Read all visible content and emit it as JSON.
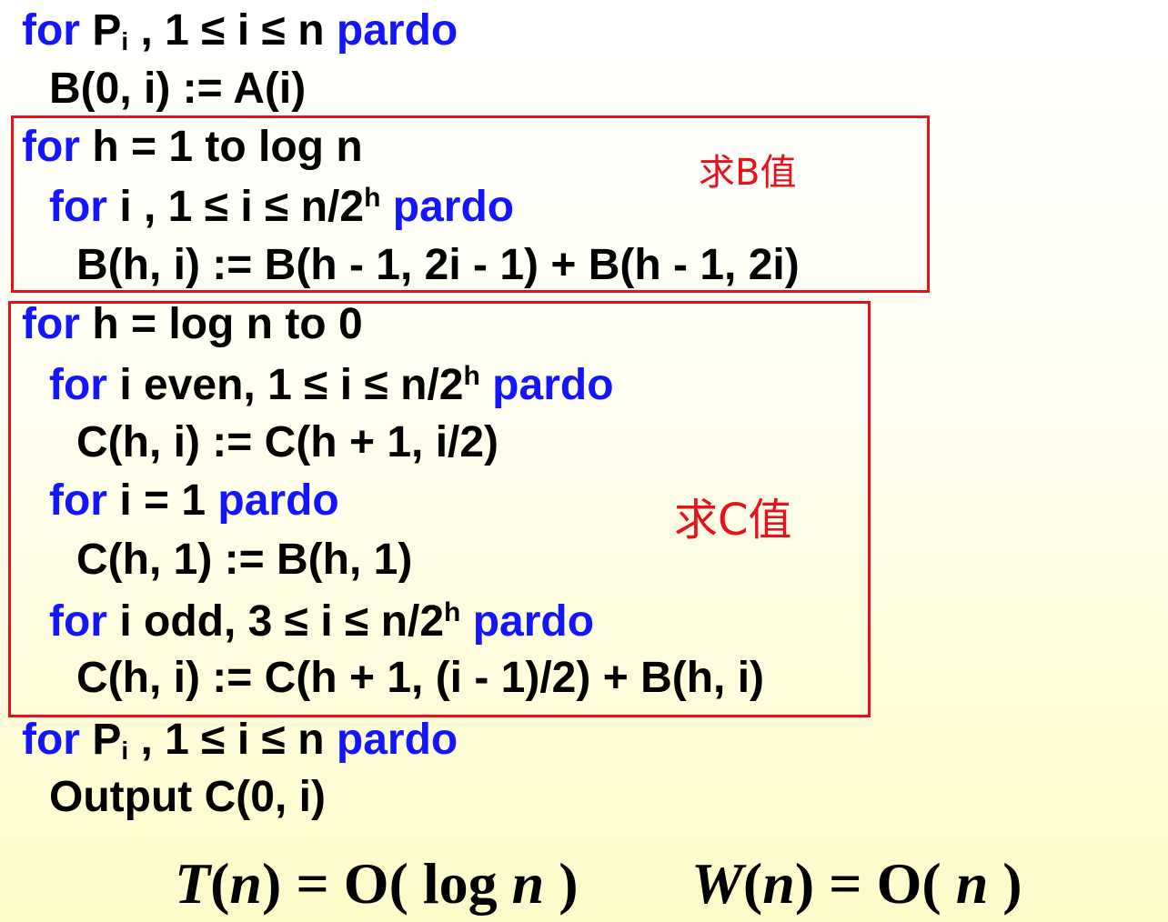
{
  "keywords": {
    "for": "for",
    "pardo": "pardo",
    "to": "to"
  },
  "code": {
    "l1_p": "P",
    "l1_sub": "i",
    "l1_range": ", 1 ≤ i ≤ n",
    "l2": "B(0, i) := A(i)",
    "l3_rest": "h = 1 to log n",
    "l4_a": "i , 1 ≤ i ≤ n/2",
    "l4_sup": "h",
    "l5": "B(h, i) := B(h - 1, 2i - 1) + B(h - 1, 2i)",
    "l6_rest": "h = log n to 0",
    "l7_a": "i even, 1 ≤ i ≤ n/2",
    "l7_sup": "h",
    "l8": "C(h, i) := C(h + 1, i/2)",
    "l9_a": "i = 1",
    "l10": "C(h, 1) := B(h, 1)",
    "l11_a": "i odd, 3 ≤ i ≤ n/2",
    "l11_sup": "h",
    "l12": "C(h, i) := C(h + 1, (i - 1)/2) + B(h, i)",
    "l13_p": "P",
    "l13_sub": "i",
    "l13_range": ", 1 ≤ i ≤ n",
    "l14": "Output C(0, i)"
  },
  "annotations": {
    "b_label": "求B值",
    "c_label": "求C值"
  },
  "complexity": {
    "t_sym": "T",
    "t_open": "(",
    "t_n": "n",
    "t_eq": ") = O( log ",
    "t_n2": "n",
    "t_close": " )",
    "w_sym": "W",
    "w_open": "(",
    "w_n": "n",
    "w_eq": ") = O( ",
    "w_n2": "n",
    "w_close": " )"
  },
  "colors": {
    "keyword": "#1414ff",
    "text": "#000000",
    "annotation": "#e8101c",
    "box_border": "#e8101c"
  }
}
